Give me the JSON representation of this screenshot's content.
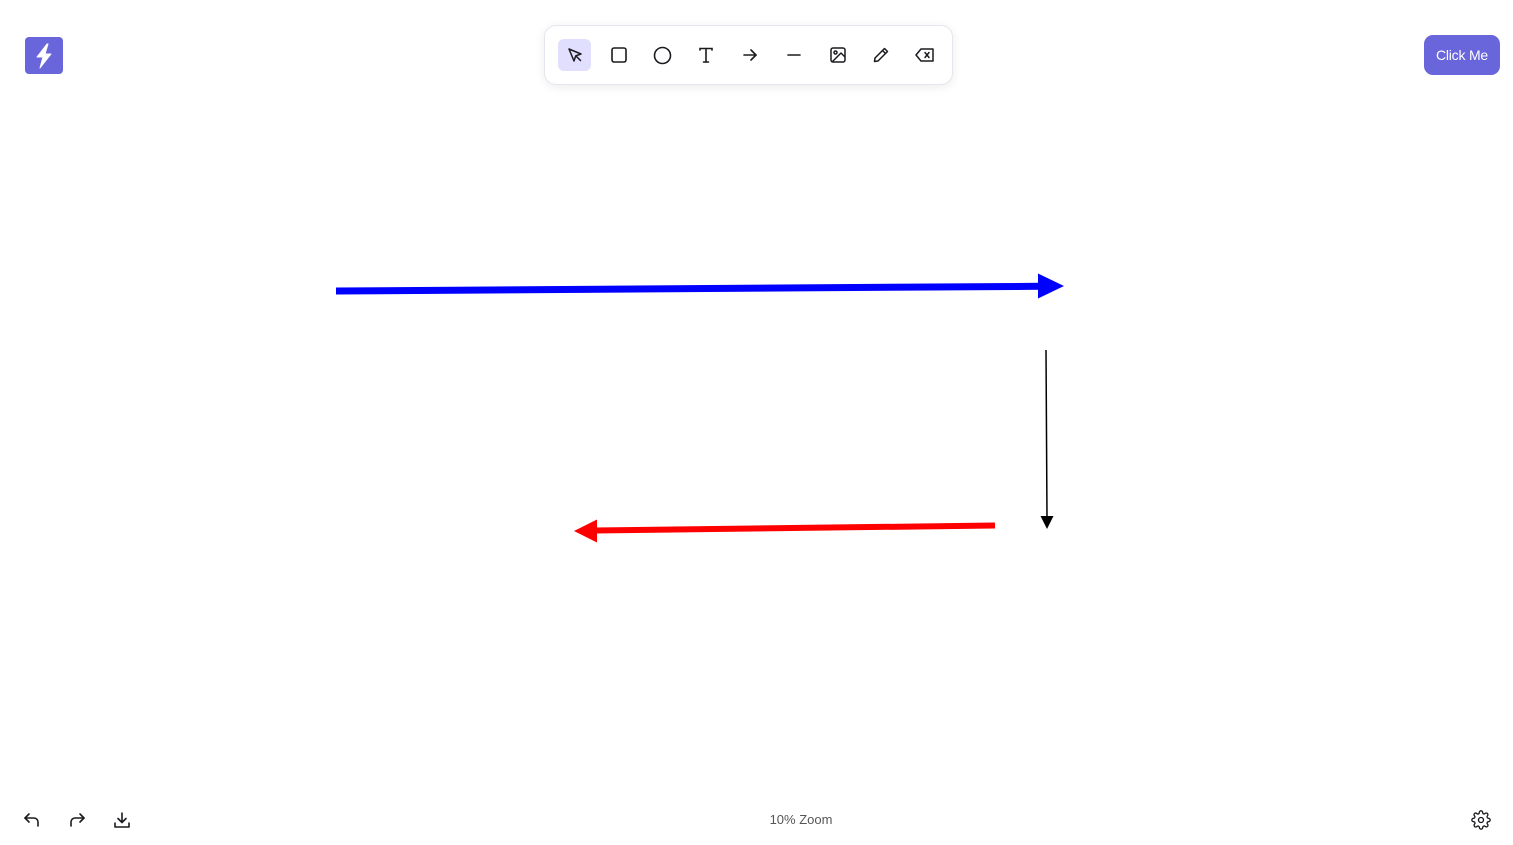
{
  "colors": {
    "accent": "#6965db",
    "active_tool_bg": "#e0dffe",
    "icon_stroke": "#1b1b1f",
    "arrow_blue": "#0000ff",
    "arrow_red": "#ff0000",
    "arrow_black": "#000000"
  },
  "logo": {
    "icon": "lightning-bolt-icon"
  },
  "toolbar": {
    "tools": [
      {
        "name": "select",
        "icon": "cursor-arrow-icon",
        "active": true
      },
      {
        "name": "rectangle",
        "icon": "square-icon",
        "active": false
      },
      {
        "name": "ellipse",
        "icon": "circle-icon",
        "active": false
      },
      {
        "name": "text",
        "icon": "text-t-icon",
        "active": false
      },
      {
        "name": "arrow",
        "icon": "arrow-right-icon",
        "active": false
      },
      {
        "name": "line",
        "icon": "line-icon",
        "active": false
      },
      {
        "name": "image",
        "icon": "image-icon",
        "active": false
      },
      {
        "name": "pencil",
        "icon": "pencil-icon",
        "active": false
      },
      {
        "name": "eraser",
        "icon": "eraser-icon",
        "active": false
      }
    ]
  },
  "header": {
    "cta_label": "Click Me"
  },
  "footer": {
    "undo_icon": "undo-icon",
    "redo_icon": "redo-icon",
    "download_icon": "download-icon",
    "zoom_label": "10% Zoom",
    "settings_icon": "gear-icon"
  }
}
